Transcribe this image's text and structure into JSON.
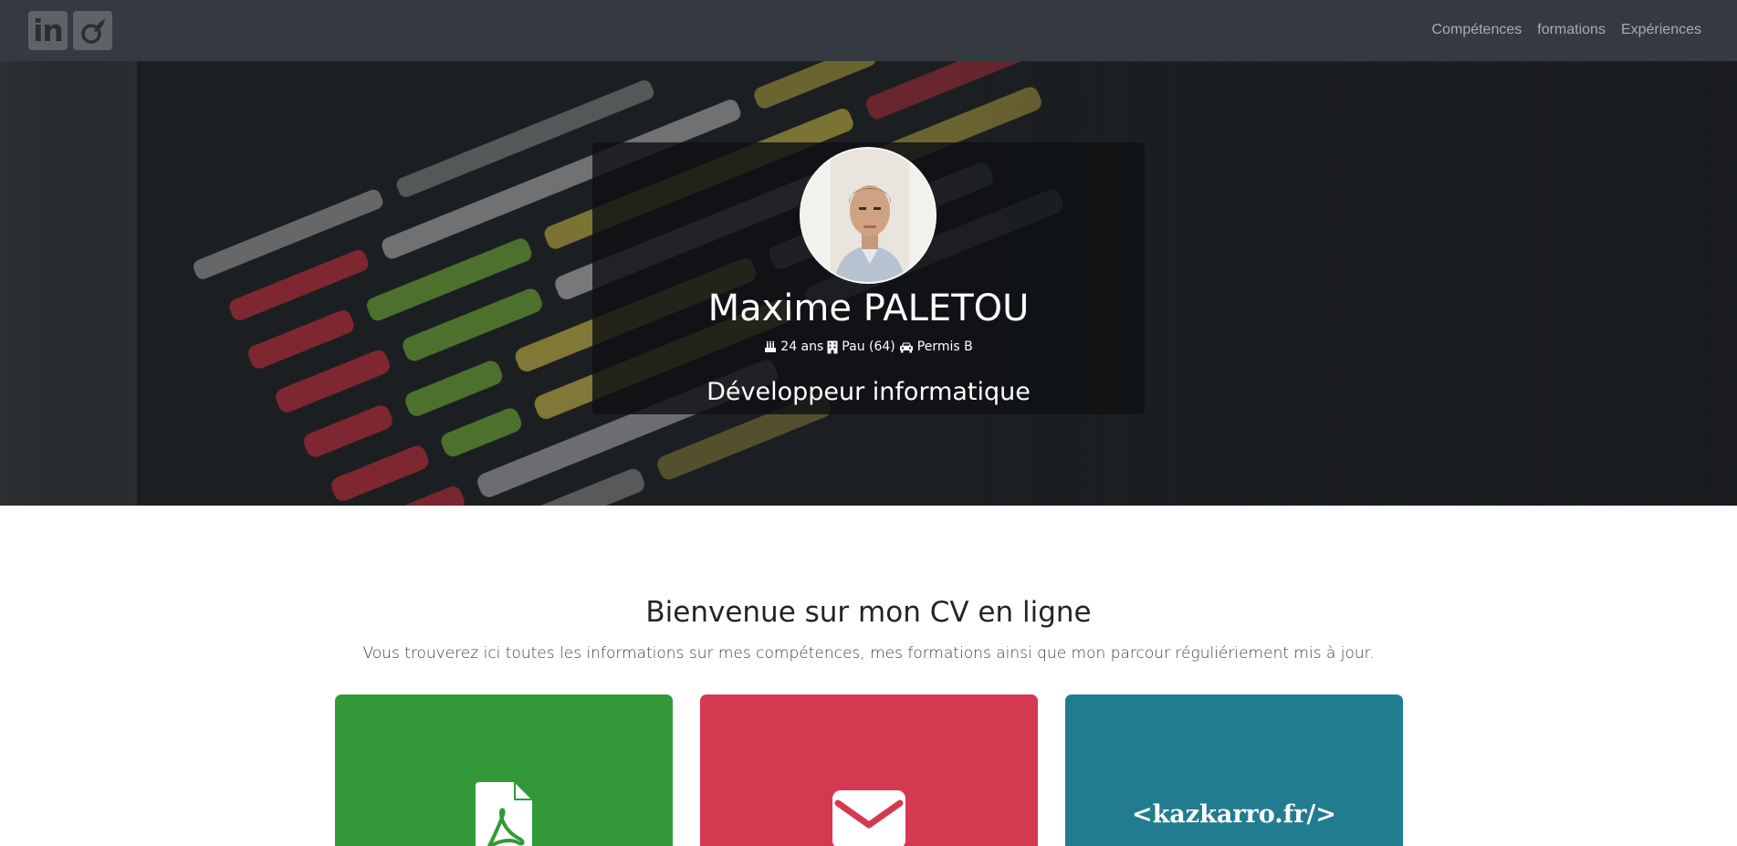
{
  "nav": {
    "social": [
      {
        "icon": "linkedin-icon",
        "label": "in"
      },
      {
        "icon": "viadeo-icon"
      }
    ],
    "links": [
      "Compétences",
      "formations",
      "Expériences"
    ]
  },
  "hero": {
    "name": "Maxime PALETOU",
    "age": "24 ans",
    "location": "Pau (64)",
    "license": "Permis B",
    "job": "Développeur informatique"
  },
  "welcome": {
    "title": "Bienvenue sur mon CV en ligne",
    "subtitle": "Vous trouverez ici toutes les informations sur mes compétences, mes formations ainsi que mon parcour réguliériement mis à jour."
  },
  "cards": {
    "cv": {
      "icon": "pdf-file-icon",
      "color": "#339938"
    },
    "mail": {
      "icon": "envelope-icon",
      "color": "#d33a51"
    },
    "site": {
      "text": "<kazkarro.fr/>",
      "color": "#227c90"
    }
  },
  "colors": {
    "navbar": "#343a40",
    "nav_link": "#a9acb0"
  }
}
